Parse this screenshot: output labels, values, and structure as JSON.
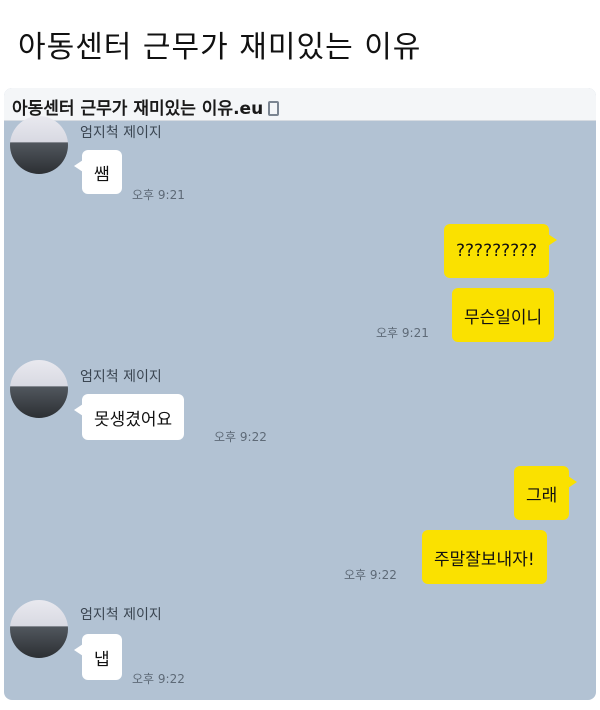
{
  "post": {
    "title": "아동센터 근무가 재미있는 이유"
  },
  "screenshot": {
    "header_title": "아동센터 근무가 재미있는 이유.eu",
    "header_icon": "phone-icon",
    "colors": {
      "chat_bg": "#b2c2d3",
      "outgoing_bubble": "#fae100",
      "incoming_bubble": "#ffffff"
    }
  },
  "messages": [
    {
      "sender": "엄지척 제이지",
      "text": "쌤",
      "time": "오후 9:21"
    },
    {
      "text": "?????????"
    },
    {
      "text": "무슨일이니",
      "time": "오후 9:21"
    },
    {
      "sender": "엄지척 제이지",
      "text": "못생겼어요",
      "time": "오후 9:22"
    },
    {
      "text": "그래"
    },
    {
      "text": "주말잘보내자!",
      "time": "오후 9:22"
    },
    {
      "sender": "엄지척 제이지",
      "text": "냅",
      "time": "오후 9:22"
    }
  ]
}
